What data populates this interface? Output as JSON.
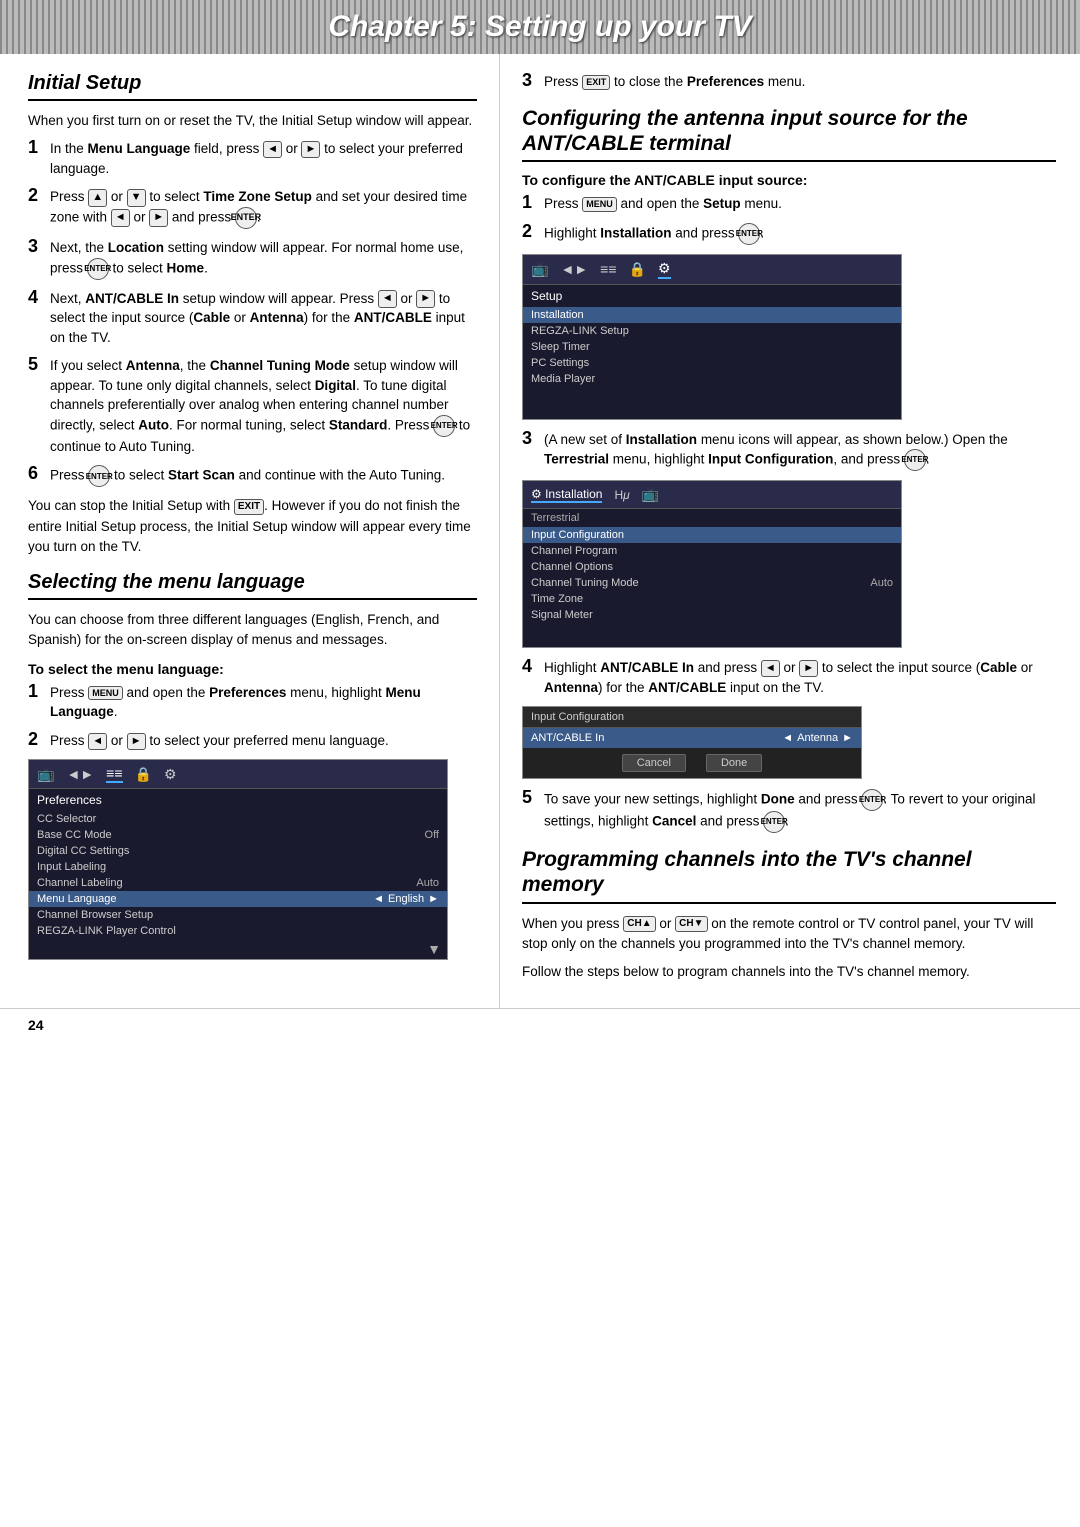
{
  "page": {
    "chapter_title": "Chapter 5: Setting up your TV",
    "page_number": "24"
  },
  "left": {
    "section1": {
      "heading": "Initial Setup",
      "intro": "When you first turn on or reset the TV, the Initial Setup window will appear.",
      "steps": [
        {
          "num": "1",
          "text": "In the Menu Language field, press ◄ or ► to select your preferred language."
        },
        {
          "num": "2",
          "text": "Press ▲ or ▼ to select Time Zone Setup and set your desired time zone with ◄ or ► and press ENTER."
        },
        {
          "num": "3",
          "text": "Next, the Location setting window will appear. For normal home use, press ENTER to select Home."
        },
        {
          "num": "4",
          "text": "Next, ANT/CABLE In setup window will appear. Press ◄ or ► to select the input source (Cable or Antenna) for the ANT/CABLE input on the TV."
        },
        {
          "num": "5",
          "text": "If you select Antenna, the Channel Tuning Mode setup window will appear. To tune only digital channels, select Digital. To tune digital channels preferentially over analog when entering channel number directly, select Auto. For normal tuning, select Standard. Press ENTER to continue to Auto Tuning."
        },
        {
          "num": "6",
          "text": "Press ENTER to select Start Scan and continue with the Auto Tuning."
        }
      ],
      "closing": "You can stop the Initial Setup with EXIT. However if you do not finish the entire Initial Setup process, the Initial Setup window will appear every time you turn on the TV."
    },
    "section2": {
      "heading": "Selecting the menu language",
      "intro": "You can choose from three different languages (English, French, and Spanish) for the on-screen display of menus and messages.",
      "sub_heading": "To select the menu language:",
      "steps": [
        {
          "num": "1",
          "text": "Press MENU and open the Preferences menu, highlight Menu Language."
        },
        {
          "num": "2",
          "text": "Press ◄ or ► to select your preferred menu language."
        }
      ],
      "menu": {
        "icons": [
          "TV",
          "◄►",
          "≡≡",
          "🔒",
          "⚙"
        ],
        "active_icon_index": 4,
        "title": "Preferences",
        "rows": [
          {
            "label": "CC Selector",
            "value": "",
            "highlighted": false
          },
          {
            "label": "Base CC Mode",
            "value": "Off",
            "highlighted": false
          },
          {
            "label": "Digital CC Settings",
            "value": "",
            "highlighted": false
          },
          {
            "label": "Input Labeling",
            "value": "",
            "highlighted": false
          },
          {
            "label": "Channel Labeling",
            "value": "Auto",
            "highlighted": false
          },
          {
            "label": "Menu Language",
            "value": "English",
            "highlighted": true
          },
          {
            "label": "Channel Browser Setup",
            "value": "",
            "highlighted": false
          },
          {
            "label": "REGZA-LINK Player Control",
            "value": "",
            "highlighted": false
          }
        ]
      }
    }
  },
  "right": {
    "step3_close": "Press EXIT to close the Preferences menu.",
    "section3": {
      "heading": "Configuring the antenna input source for the ANT/CABLE terminal",
      "sub_heading": "To configure the ANT/CABLE input source:",
      "steps": [
        {
          "num": "1",
          "text": "Press MENU and open the Setup menu."
        },
        {
          "num": "2",
          "text": "Highlight Installation and press ENTER."
        }
      ],
      "menu1": {
        "icons": [
          "TV",
          "◄►",
          "≡≡",
          "🔒",
          "⚙"
        ],
        "active_icon_index": 4,
        "title": "Setup",
        "rows": [
          {
            "label": "Installation",
            "value": "",
            "highlighted": true
          },
          {
            "label": "REGZA-LINK Setup",
            "value": "",
            "highlighted": false
          },
          {
            "label": "Sleep Timer",
            "value": "",
            "highlighted": false
          },
          {
            "label": "PC Settings",
            "value": "",
            "highlighted": false
          },
          {
            "label": "Media Player",
            "value": "",
            "highlighted": false
          }
        ]
      },
      "step3": "(A new set of Installation menu icons will appear, as shown below.) Open the Terrestrial menu, highlight Input Configuration, and press ENTER.",
      "menu2": {
        "icons": [
          "⚙",
          "Hμ",
          "📺"
        ],
        "active_icon_index": 0,
        "icon_labels": [
          "Installation",
          "Hμ",
          ""
        ],
        "title": "",
        "rows": [
          {
            "label": "Terrestrial",
            "value": "",
            "highlighted": false,
            "is_label": true
          },
          {
            "label": "Input Configuration",
            "value": "",
            "highlighted": true
          },
          {
            "label": "Channel Program",
            "value": "",
            "highlighted": false
          },
          {
            "label": "Channel Options",
            "value": "",
            "highlighted": false
          },
          {
            "label": "Channel Tuning Mode",
            "value": "Auto",
            "highlighted": false
          },
          {
            "label": "Time Zone",
            "value": "",
            "highlighted": false
          },
          {
            "label": "Signal Meter",
            "value": "",
            "highlighted": false
          }
        ]
      },
      "step4": "Highlight ANT/CABLE In and press ◄ or ► to select the input source (Cable or Antenna) for the ANT/CABLE input on the TV.",
      "menu3": {
        "title": "Input Configuration",
        "rows": [
          {
            "label": "ANT/CABLE In",
            "value": "Antenna",
            "highlighted": true
          }
        ],
        "buttons": [
          "Cancel",
          "Done"
        ]
      },
      "step5": "To save your new settings, highlight Done and press ENTER. To revert to your original settings, highlight Cancel and press ENTER."
    },
    "section4": {
      "heading": "Programming channels into the TV's channel memory",
      "intro": "When you press CH▲ or CH▼ on the remote control or TV control panel, your TV will stop only on the channels you programmed into the TV's channel memory.",
      "closing": "Follow the steps below to program channels into the TV's channel memory."
    }
  }
}
